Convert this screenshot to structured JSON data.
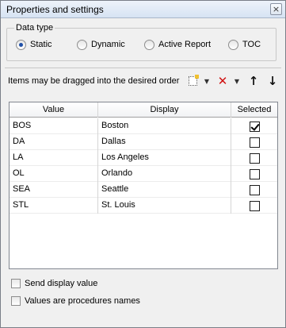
{
  "window": {
    "title": "Properties and settings",
    "close_glyph": "×"
  },
  "data_type": {
    "legend": "Data type",
    "options": [
      {
        "label": "Static",
        "selected": true
      },
      {
        "label": "Dynamic",
        "selected": false
      },
      {
        "label": "Active Report",
        "selected": false
      },
      {
        "label": "TOC",
        "selected": false
      }
    ]
  },
  "toolbar": {
    "hint": "Items may be dragged into the desired order",
    "icons": [
      "new-item-icon",
      "dropdown-arrow-icon",
      "delete-icon",
      "dropdown-arrow-icon",
      "move-up-icon",
      "move-down-icon"
    ]
  },
  "grid": {
    "columns": [
      "Value",
      "Display",
      "Selected"
    ],
    "rows": [
      {
        "value": "BOS",
        "display": "Boston",
        "selected": true
      },
      {
        "value": "DA",
        "display": "Dallas",
        "selected": false
      },
      {
        "value": "LA",
        "display": "Los Angeles",
        "selected": false
      },
      {
        "value": "OL",
        "display": "Orlando",
        "selected": false
      },
      {
        "value": "SEA",
        "display": "Seattle",
        "selected": false
      },
      {
        "value": "STL",
        "display": "St. Louis",
        "selected": false
      }
    ]
  },
  "options": {
    "send_display_value": {
      "label": "Send display value",
      "checked": false
    },
    "procedures_names": {
      "label": "Values are procedures names",
      "checked": false
    }
  },
  "colors": {
    "delete": "#d01010",
    "radio_dot": "#2050a8"
  }
}
